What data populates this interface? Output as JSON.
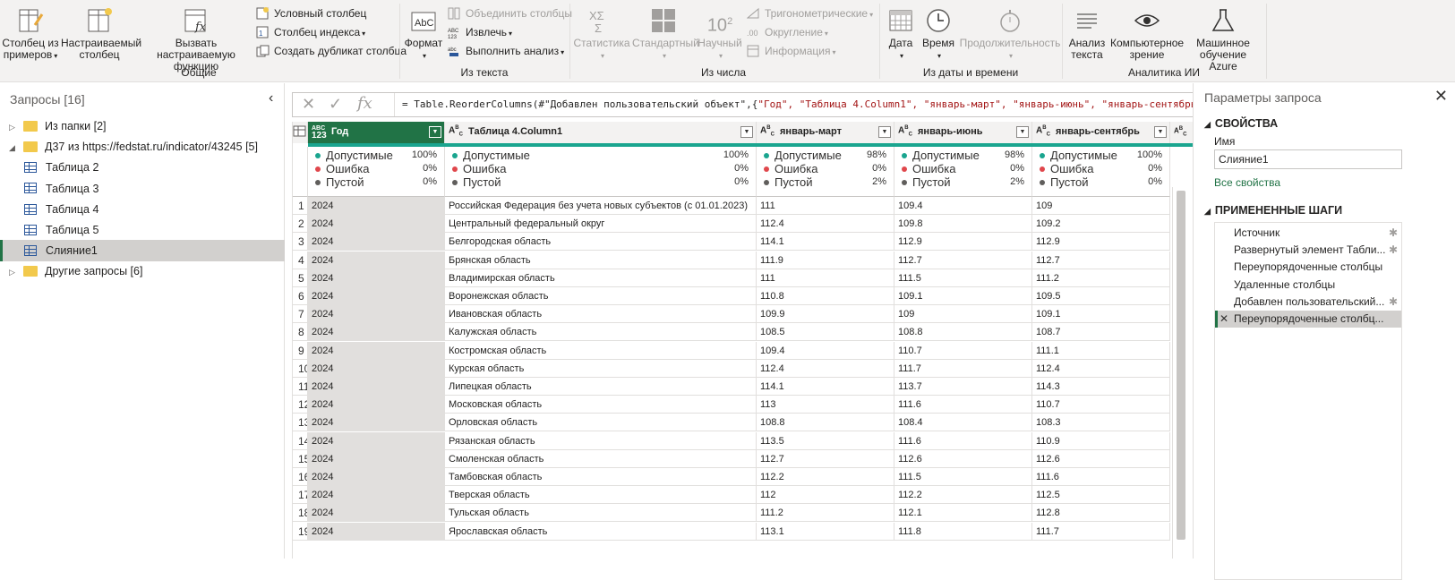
{
  "ribbon": {
    "buttons": {
      "col_from_examples": "Столбец из примеров",
      "custom_column": "Настраиваемый столбец",
      "invoke_custom_function": "Вызвать настраиваемую функцию",
      "conditional_column": "Условный столбец",
      "index_column": "Столбец индекса",
      "duplicate_column": "Создать дубликат столбца",
      "format": "Формат",
      "merge_columns": "Объединить столбцы",
      "extract": "Извлечь",
      "parse": "Выполнить анализ",
      "statistics": "Статистика",
      "standard": "Стандартный",
      "scientific": "Научный",
      "trigonometry": "Тригонометрические",
      "rounding": "Округление",
      "information": "Информация",
      "date": "Дата",
      "time": "Время",
      "duration": "Продолжительность",
      "text_analytics": "Анализ текста",
      "vision": "Компьютерное зрение",
      "azure_ml": "Машинное обучение Azure",
      "scientific_sup": "2",
      "scientific_base": "10"
    },
    "groups": {
      "general": "Общие",
      "from_text": "Из текста",
      "from_number": "Из числа",
      "from_datetime": "Из даты и времени",
      "ai": "Аналитика ИИ"
    }
  },
  "queries": {
    "header": "Запросы [16]",
    "items": [
      {
        "label": "Из папки [2]",
        "type": "folder",
        "indent": 0,
        "tri": "▷"
      },
      {
        "label": "Д37 из https://fedstat.ru/indicator/43245 [5]",
        "type": "folder",
        "indent": 0,
        "tri": "◢"
      },
      {
        "label": "Таблица 2",
        "type": "table",
        "indent": 1
      },
      {
        "label": "Таблица 3",
        "type": "table",
        "indent": 1
      },
      {
        "label": "Таблица 4",
        "type": "table",
        "indent": 1
      },
      {
        "label": "Таблица 5",
        "type": "table",
        "indent": 1
      },
      {
        "label": "Слияние1",
        "type": "table",
        "indent": 1,
        "selected": true
      },
      {
        "label": "Другие запросы [6]",
        "type": "folder",
        "indent": 0,
        "tri": "▷"
      }
    ]
  },
  "formula": {
    "text_prefix": "= Table.ReorderColumns(#\"Добавлен пользовательский объект\",{",
    "text_strings": "\"Год\", \"Таблица 4.Column1\", \"январь-март\", \"январь-июнь\", \"январь-сентябрь\","
  },
  "columns": [
    {
      "name": "Год",
      "type": "ABC 123",
      "valid": "100%",
      "error": "0%",
      "empty": "0%"
    },
    {
      "name": "Таблица 4.Column1",
      "type": "ABC",
      "valid": "100%",
      "error": "0%",
      "empty": "0%"
    },
    {
      "name": "январь-март",
      "type": "ABC",
      "valid": "98%",
      "error": "0%",
      "empty": "2%"
    },
    {
      "name": "январь-июнь",
      "type": "ABC",
      "valid": "98%",
      "error": "0%",
      "empty": "2%"
    },
    {
      "name": "январь-сентябрь",
      "type": "ABC",
      "valid": "100%",
      "error": "0%",
      "empty": "0%"
    }
  ],
  "profile_labels": {
    "valid": "Допустимые",
    "error": "Ошибка",
    "empty": "Пустой"
  },
  "rows": [
    [
      "1",
      "2024",
      "Российская Федерация без учета новых субъектов (с 01.01.2023)",
      "111",
      "109.4",
      "109"
    ],
    [
      "2",
      "2024",
      "Центральный федеральный округ",
      "112.4",
      "109.8",
      "109.2"
    ],
    [
      "3",
      "2024",
      "Белгородская область",
      "114.1",
      "112.9",
      "112.9"
    ],
    [
      "4",
      "2024",
      "Брянская область",
      "111.9",
      "112.7",
      "112.7"
    ],
    [
      "5",
      "2024",
      "Владимирская область",
      "111",
      "111.5",
      "111.2"
    ],
    [
      "6",
      "2024",
      "Воронежская область",
      "110.8",
      "109.1",
      "109.5"
    ],
    [
      "7",
      "2024",
      "Ивановская область",
      "109.9",
      "109",
      "109.1"
    ],
    [
      "8",
      "2024",
      "Калужская область",
      "108.5",
      "108.8",
      "108.7"
    ],
    [
      "9",
      "2024",
      "Костромская область",
      "109.4",
      "110.7",
      "111.1"
    ],
    [
      "10",
      "2024",
      "Курская область",
      "112.4",
      "111.7",
      "112.4"
    ],
    [
      "11",
      "2024",
      "Липецкая область",
      "114.1",
      "113.7",
      "114.3"
    ],
    [
      "12",
      "2024",
      "Московская область",
      "113",
      "111.6",
      "110.7"
    ],
    [
      "13",
      "2024",
      "Орловская область",
      "108.8",
      "108.4",
      "108.3"
    ],
    [
      "14",
      "2024",
      "Рязанская область",
      "113.5",
      "111.6",
      "110.9"
    ],
    [
      "15",
      "2024",
      "Смоленская область",
      "112.7",
      "112.6",
      "112.6"
    ],
    [
      "16",
      "2024",
      "Тамбовская область",
      "112.2",
      "111.5",
      "111.6"
    ],
    [
      "17",
      "2024",
      "Тверская область",
      "112",
      "112.2",
      "112.5"
    ],
    [
      "18",
      "2024",
      "Тульская область",
      "111.2",
      "112.1",
      "112.8"
    ],
    [
      "19",
      "2024",
      "Ярославская область",
      "113.1",
      "111.8",
      "111.7"
    ]
  ],
  "query_settings": {
    "title": "Параметры запроса",
    "properties_header": "СВОЙСТВА",
    "name_label": "Имя",
    "name_value": "Слияние1",
    "all_properties": "Все свойства",
    "steps_header": "ПРИМЕНЕННЫЕ ШАГИ",
    "steps": [
      {
        "label": "Источник",
        "gear": true
      },
      {
        "label": "Развернутый элемент Табли...",
        "gear": true
      },
      {
        "label": "Переупорядоченные столбцы",
        "gear": false
      },
      {
        "label": "Удаленные столбцы",
        "gear": false
      },
      {
        "label": "Добавлен пользовательский...",
        "gear": true
      },
      {
        "label": "Переупорядоченные столбц...",
        "gear": false,
        "selected": true
      }
    ]
  },
  "colors": {
    "accent": "#217346",
    "quality": "#1aa58f",
    "error": "#e0474c",
    "empty": "#605e5c"
  }
}
